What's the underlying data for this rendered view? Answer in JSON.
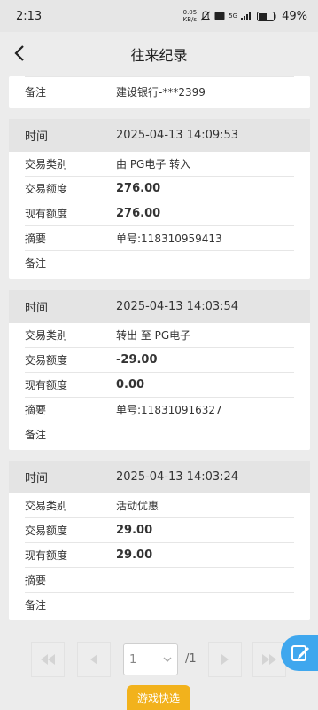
{
  "status_bar": {
    "time": "2:13",
    "net_speed_top": "0.05",
    "net_speed_bottom": "KB/s",
    "signal_label": "5G",
    "battery": "49%"
  },
  "header": {
    "title": "往来纪录"
  },
  "partial_card": {
    "remark_label": "备注",
    "remark_value": "建设银行-***2399"
  },
  "labels": {
    "time": "时间",
    "type": "交易类别",
    "amount": "交易额度",
    "balance": "现有额度",
    "summary": "摘要",
    "remark": "备注"
  },
  "records": [
    {
      "time": "2025-04-13 14:09:53",
      "type": "由 PG电子 转入",
      "amount": "276.00",
      "balance": "276.00",
      "summary": "单号:118310959413",
      "remark": ""
    },
    {
      "time": "2025-04-13 14:03:54",
      "type": "转出 至 PG电子",
      "amount": "-29.00",
      "balance": "0.00",
      "summary": "单号:118310916327",
      "remark": ""
    },
    {
      "time": "2025-04-13 14:03:24",
      "type": "活动优惠",
      "amount": "29.00",
      "balance": "29.00",
      "summary": "",
      "remark": ""
    }
  ],
  "pagination": {
    "current_page": "1",
    "total_pages": "/1"
  },
  "quick_tab": {
    "label": "游戏快选"
  },
  "colors": {
    "accent_blue": "#3fa7ee",
    "quick_tab_yellow": "#f2b21c"
  }
}
